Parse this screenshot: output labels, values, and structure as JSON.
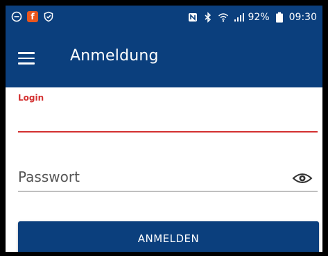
{
  "status_bar": {
    "left_icons": [
      "minus-circle-icon",
      "app-notification-icon",
      "shield-check-icon"
    ],
    "app_icon_letter": "f",
    "right_icons": [
      "nfc-icon",
      "bluetooth-icon",
      "wifi-icon",
      "signal-icon"
    ],
    "battery": "92%",
    "time": "09:30"
  },
  "appbar": {
    "title": "Anmeldung",
    "menu_icon": "hamburger-menu-icon"
  },
  "form": {
    "login_label": "Login",
    "login_value": "",
    "password_placeholder": "Passwort",
    "password_value": "",
    "show_password_icon": "eye-icon",
    "submit_label": "ANMELDEN"
  },
  "colors": {
    "primary": "#0b3f7d",
    "error": "#d32f2f"
  }
}
